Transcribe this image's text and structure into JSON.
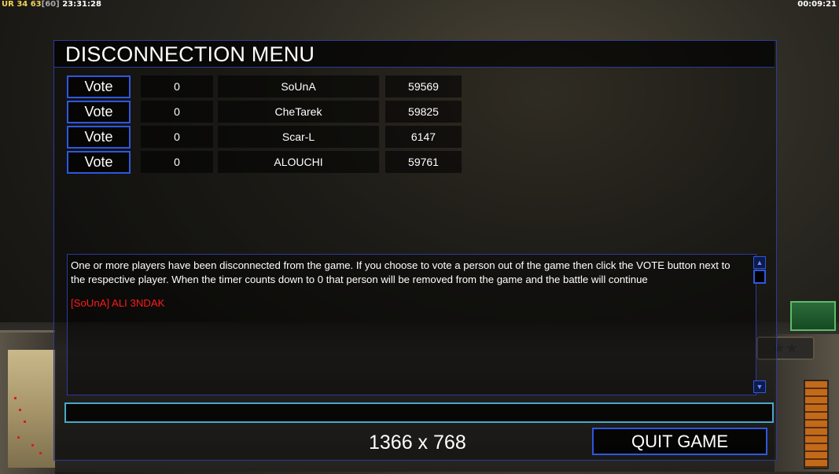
{
  "hud": {
    "ur_label": "UR",
    "fps": "34 63",
    "fps_max": "[60]",
    "clock": "23:31:28",
    "game_timer": "00:09:21"
  },
  "dialog": {
    "title": "DISCONNECTION MENU",
    "vote_label": "Vote",
    "players": [
      {
        "votes": "0",
        "name": "SoUnA",
        "ping": "59569"
      },
      {
        "votes": "0",
        "name": "CheTarek",
        "ping": "59825"
      },
      {
        "votes": "0",
        "name": "Scar-L",
        "ping": "6147"
      },
      {
        "votes": "0",
        "name": "ALOUCHI",
        "ping": "59761"
      }
    ],
    "message": "One or more players have been disconnected from the game. If you choose to vote a person out of the game then click the VOTE button next to the respective player. When the timer counts down to 0 that person will be removed from the game and the battle will continue",
    "chat_line": "[SoUnA] ALI 3NDAK",
    "chat_input_value": "",
    "resolution": "1366 x 768",
    "quit_label": "QUIT GAME"
  },
  "colors": {
    "accent_blue": "#2e57e0",
    "chat_red": "#ff1a1a",
    "input_cyan": "#4aa8c8"
  }
}
